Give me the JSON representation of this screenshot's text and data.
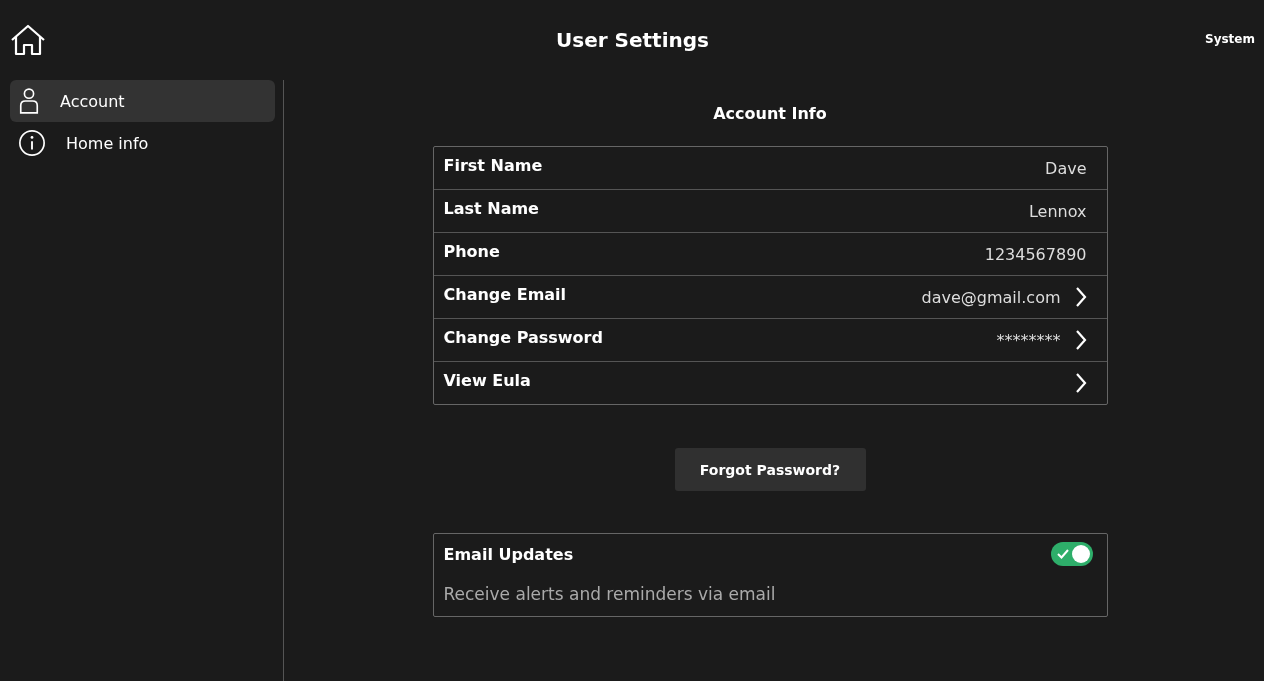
{
  "header": {
    "title": "User Settings",
    "system_link": "System"
  },
  "sidebar": {
    "items": [
      {
        "label": "Account",
        "kind": "person",
        "selected": true
      },
      {
        "label": "Home info",
        "kind": "info",
        "selected": false
      }
    ]
  },
  "account_info": {
    "title": "Account Info",
    "rows": [
      {
        "label": "First Name",
        "value": "Dave",
        "kind": "value"
      },
      {
        "label": "Last Name",
        "value": "Lennox",
        "kind": "value"
      },
      {
        "label": "Phone",
        "value": "1234567890",
        "kind": "value"
      },
      {
        "label": "Change Email",
        "value": "dave@gmail.com",
        "kind": "link"
      },
      {
        "label": "Change Password",
        "value": "********",
        "kind": "link"
      },
      {
        "label": "View Eula",
        "kind": "link"
      }
    ]
  },
  "forgot_button": "Forgot Password?",
  "email_updates": {
    "title": "Email Updates",
    "description": "Receive alerts and reminders via email",
    "on": true
  }
}
